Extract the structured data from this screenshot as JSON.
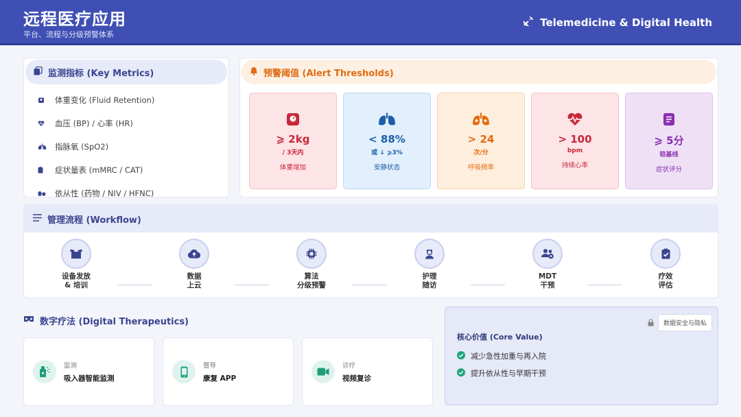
{
  "header": {
    "title": "远程医疗应用",
    "subtitle": "平台、流程与分级预警体系",
    "brand": "Telemedicine & Digital Health"
  },
  "metrics": {
    "title": "监测指标 (Key Metrics)",
    "items": [
      {
        "icon": "weight-icon",
        "label": "体重变化 (Fluid Retention)"
      },
      {
        "icon": "heart-pulse-icon",
        "label": "血压 (BP) / 心率 (HR)"
      },
      {
        "icon": "lungs-icon",
        "label": "指脉氧 (SpO2)"
      },
      {
        "icon": "clipboard-icon",
        "label": "症状量表 (mMRC / CAT)"
      },
      {
        "icon": "pills-icon",
        "label": "依从性 (药物 / NIV / HFNC)"
      }
    ]
  },
  "alerts": {
    "title": "预警阈值 (Alert Thresholds)",
    "cards": [
      {
        "icon": "scale-icon",
        "value": "⩾ 2kg",
        "unit": "/ 3天内",
        "label": "体重增加",
        "bg": "#fde4e6",
        "border": "#f6c3c8",
        "color": "#c6283a",
        "label_color": "#c6283a"
      },
      {
        "icon": "lungs-icon",
        "value": "< 88%",
        "unit": "或 ↓ ⩾3%",
        "label": "安静状态",
        "bg": "#e2effc",
        "border": "#bcd8f3",
        "color": "#1d5fa8",
        "label_color": "#1d5fa8"
      },
      {
        "icon": "lungs-virus-icon",
        "value": "> 24",
        "unit": "次/分",
        "label": "呼吸频率",
        "bg": "#fdeedd",
        "border": "#f6d3ab",
        "color": "#e56a10",
        "label_color": "#e56a10"
      },
      {
        "icon": "heart-pulse-icon",
        "value": "> 100",
        "unit": "bpm",
        "label": "持续心率",
        "bg": "#fde4e6",
        "border": "#f6c3c8",
        "color": "#c6283a",
        "label_color": "#c6283a"
      },
      {
        "icon": "file-list-icon",
        "value": "⩾ 5分",
        "unit": "较基线",
        "label": "症状评分",
        "bg": "#efe0f6",
        "border": "#dcc1ec",
        "color": "#8a2fb0",
        "label_color": "#8a2fb0"
      }
    ]
  },
  "workflow": {
    "title": "管理流程 (Workflow)",
    "steps": [
      {
        "icon": "box-open-icon",
        "line1": "设备发放",
        "line2": "& 培训"
      },
      {
        "icon": "cloud-upload-icon",
        "line1": "数据",
        "line2": "上云"
      },
      {
        "icon": "microchip-icon",
        "line1": "算法",
        "line2": "分级预警"
      },
      {
        "icon": "nurse-icon",
        "line1": "护理",
        "line2": "随访"
      },
      {
        "icon": "team-icon",
        "line1": "MDT",
        "line2": "干预"
      },
      {
        "icon": "clipboard-check-icon",
        "line1": "疗效",
        "line2": "评估"
      }
    ]
  },
  "therapeutics": {
    "title": "数字疗法 (Digital Therapeutics)",
    "cards": [
      {
        "icon": "inhaler-icon",
        "key": "监测",
        "value": "吸入器智能监测"
      },
      {
        "icon": "mobile-icon",
        "key": "督导",
        "value": "康复 APP"
      },
      {
        "icon": "video-icon",
        "key": "诊疗",
        "value": "视频复诊"
      }
    ]
  },
  "core_value": {
    "privacy": "数据安全与隐私",
    "title": "核心价值 (Core Value)",
    "items": [
      "减少急性加重与再入院",
      "提升依从性与早期干预"
    ]
  },
  "colors": {
    "header_bg": "#3f4fb4",
    "accent_indigo": "#3a4590",
    "accent_orange": "#e06c14",
    "accent_green": "#21a67a"
  }
}
